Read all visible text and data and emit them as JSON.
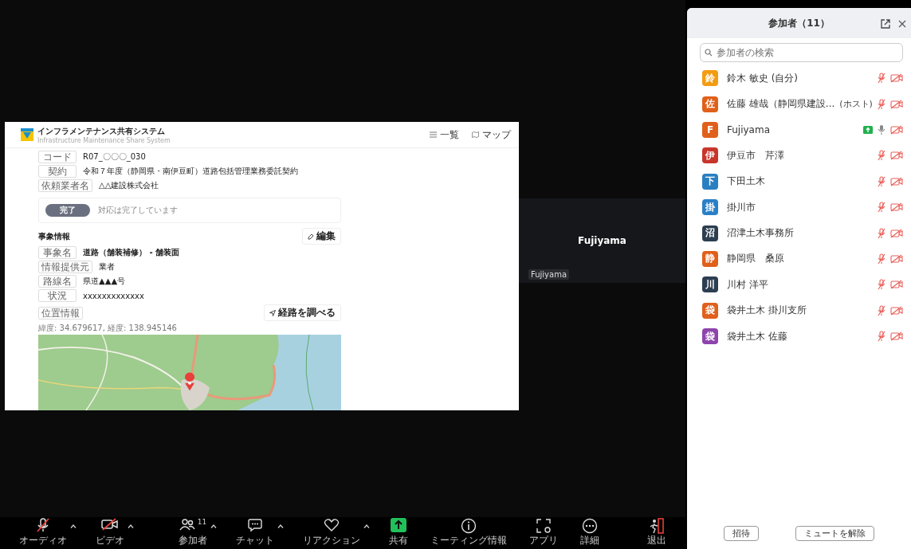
{
  "shared_screen": {
    "app_title": "インフラメンテナンス共有システム",
    "app_subtitle": "Infrastructure Maintenance Share System",
    "nav": [
      {
        "label": "一覧",
        "kind": "list"
      },
      {
        "label": "マップ",
        "kind": "map"
      }
    ],
    "header_fields": [
      {
        "label": "コード",
        "value": "R07_〇〇〇_030"
      },
      {
        "label": "契約",
        "value": "令和７年度（静岡県・南伊豆町）道路包括管理業務委託契約"
      },
      {
        "label": "依頼業者名",
        "value": "△△建設株式会社"
      }
    ],
    "status": {
      "badge": "完了",
      "text": "対応は完了しています"
    },
    "section_title": "事象情報",
    "edit_button": "編集",
    "event_fields": [
      {
        "label": "事象名",
        "value": "道路（舗装補修） - 舗装面",
        "emphasis": true
      },
      {
        "label": "情報提供元",
        "value": "業者",
        "emphasis": false
      },
      {
        "label": "路線名",
        "value": "県道▲▲▲号",
        "emphasis": false
      },
      {
        "label": "状況",
        "value": "xxxxxxxxxxxxx",
        "emphasis": false
      }
    ],
    "location_label": "位置情報",
    "route_button": "経路を調べる",
    "coordinates": "緯度: 34.679617, 経度: 138.945146"
  },
  "video_tile": {
    "name": "Fujiyama",
    "label": "Fujiyama"
  },
  "participants_panel": {
    "title": "参加者（11）",
    "search": {
      "placeholder": "参加者の検索"
    },
    "participants": [
      {
        "avatar": "鈴",
        "color": "#f39c12",
        "name": "鈴木 敏史 (自分)",
        "mic_muted": true,
        "sharing": false
      },
      {
        "avatar": "佐",
        "color": "#e0601a",
        "name": "佐藤 雄哉（静岡県建設...",
        "role": "(ホスト)",
        "mic_muted": true,
        "sharing": false
      },
      {
        "avatar": "F",
        "color": "#e0601a",
        "name": "Fujiyama",
        "mic_muted": false,
        "sharing": true
      },
      {
        "avatar": "伊",
        "color": "#c8352b",
        "name": "伊豆市　芹澤",
        "mic_muted": true,
        "sharing": false
      },
      {
        "avatar": "下",
        "color": "#2a7fc1",
        "name": "下田土木",
        "mic_muted": true,
        "sharing": false
      },
      {
        "avatar": "掛",
        "color": "#2a80c6",
        "name": "掛川市",
        "mic_muted": true,
        "sharing": false
      },
      {
        "avatar": "沼",
        "color": "#2c3e50",
        "name": "沼津土木事務所",
        "mic_muted": true,
        "sharing": false
      },
      {
        "avatar": "静",
        "color": "#e0601b",
        "name": "静岡県　桑原",
        "mic_muted": true,
        "sharing": false
      },
      {
        "avatar": "川",
        "color": "#2c3e51",
        "name": "川村 洋平",
        "mic_muted": true,
        "sharing": false
      },
      {
        "avatar": "袋",
        "color": "#e0601c",
        "name": "袋井土木 掛川支所",
        "mic_muted": true,
        "sharing": false
      },
      {
        "avatar": "袋",
        "color": "#8e44ad",
        "name": "袋井土木 佐藤",
        "mic_muted": true,
        "sharing": false
      }
    ],
    "buttons": [
      "招待",
      "ミュートを解除"
    ]
  },
  "toolbar": {
    "left": [
      {
        "kind": "audio",
        "label": "オーディオ",
        "caret": true
      },
      {
        "kind": "video",
        "label": "ビデオ",
        "caret": true
      }
    ],
    "center": [
      {
        "kind": "participants",
        "label": "参加者",
        "badge": "11",
        "caret": true
      },
      {
        "kind": "chat",
        "label": "チャット",
        "caret": true
      },
      {
        "kind": "reaction",
        "label": "リアクション",
        "caret": true
      },
      {
        "kind": "share",
        "label": "共有",
        "caret": false
      },
      {
        "kind": "info",
        "label": "ミーティング情報",
        "caret": false
      },
      {
        "kind": "apps",
        "label": "アプリ",
        "caret": false
      },
      {
        "kind": "more",
        "label": "詳細",
        "caret": false
      }
    ],
    "right": [
      {
        "kind": "leave",
        "label": "退出",
        "caret": false
      }
    ]
  }
}
